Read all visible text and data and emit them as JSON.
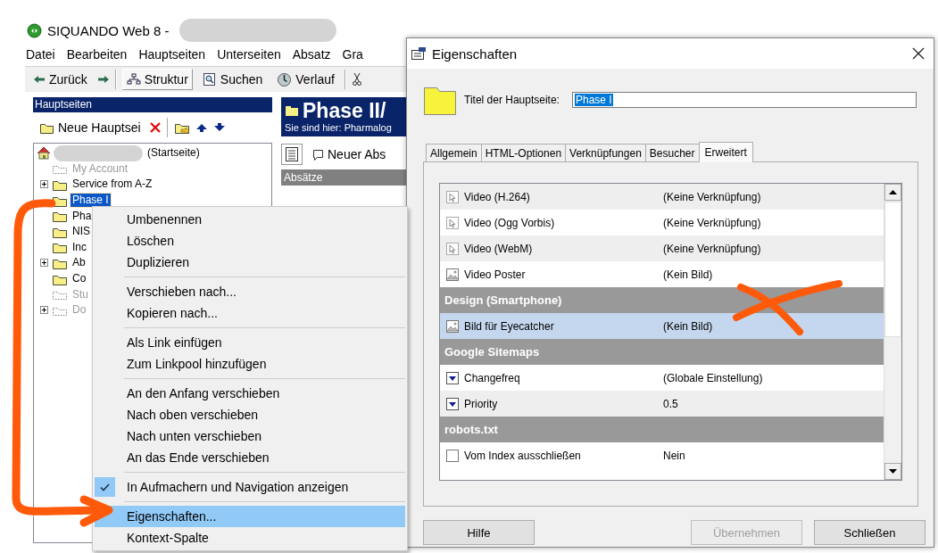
{
  "app": {
    "title": "SIQUANDO Web 8 -",
    "menu": [
      "Datei",
      "Bearbeiten",
      "Hauptseiten",
      "Unterseiten",
      "Absatz",
      "Gra"
    ],
    "toolbar": {
      "back": "Zurück",
      "views": [
        {
          "label": "Struktur",
          "selected": true
        },
        {
          "label": "Suchen",
          "selected": false
        },
        {
          "label": "Verlauf",
          "selected": false
        }
      ]
    },
    "pages_panel": {
      "title": "Hauptseiten",
      "new_button": "Neue Hauptsei",
      "tree": [
        {
          "label": "(Startseite)",
          "kind": "home",
          "disabled": false,
          "selected": false,
          "children": [
            {
              "label": "My Account",
              "kind": "folder",
              "disabled": true,
              "selected": false,
              "collapsed": false
            },
            {
              "label": "Service from A-Z",
              "kind": "folder",
              "disabled": false,
              "selected": false,
              "collapsed": true
            },
            {
              "label": "Phase I",
              "kind": "folder",
              "disabled": false,
              "selected": true,
              "collapsed": false
            },
            {
              "label": "Pha",
              "kind": "folder",
              "disabled": false,
              "selected": false,
              "collapsed": false
            },
            {
              "label": "NIS",
              "kind": "folder",
              "disabled": false,
              "selected": false,
              "collapsed": false
            },
            {
              "label": "Inc",
              "kind": "folder",
              "disabled": false,
              "selected": false,
              "collapsed": false
            },
            {
              "label": "Ab",
              "kind": "folder",
              "disabled": false,
              "selected": false,
              "collapsed": true
            },
            {
              "label": "Co",
              "kind": "folder",
              "disabled": false,
              "selected": false,
              "collapsed": false
            },
            {
              "label": "Stu",
              "kind": "folder",
              "disabled": true,
              "selected": false,
              "collapsed": false
            },
            {
              "label": "Do",
              "kind": "folder",
              "disabled": true,
              "selected": false,
              "collapsed": true
            }
          ]
        }
      ]
    },
    "page_panel": {
      "title": "Phase II/",
      "breadcrumb": "Sie sind hier: Pharmalog",
      "new_button": "Neuer Abs",
      "section": "Absätze"
    }
  },
  "context_menu": {
    "groups": [
      [
        {
          "label": "Umbenennen",
          "checked": false,
          "selected": false
        },
        {
          "label": "Löschen",
          "checked": false,
          "selected": false
        },
        {
          "label": "Duplizieren",
          "checked": false,
          "selected": false
        }
      ],
      [
        {
          "label": "Verschieben nach...",
          "checked": false,
          "selected": false
        },
        {
          "label": "Kopieren nach...",
          "checked": false,
          "selected": false
        }
      ],
      [
        {
          "label": "Als Link einfügen",
          "checked": false,
          "selected": false
        },
        {
          "label": "Zum Linkpool hinzufügen",
          "checked": false,
          "selected": false
        }
      ],
      [
        {
          "label": "An den Anfang verschieben",
          "checked": false,
          "selected": false
        },
        {
          "label": "Nach oben verschieben",
          "checked": false,
          "selected": false
        },
        {
          "label": "Nach unten verschieben",
          "checked": false,
          "selected": false
        },
        {
          "label": "An das Ende verschieben",
          "checked": false,
          "selected": false
        }
      ],
      [
        {
          "label": "In Aufmachern und Navigation anzeigen",
          "checked": true,
          "selected": false
        }
      ],
      [
        {
          "label": "Eigenschaften...",
          "checked": false,
          "selected": true
        },
        {
          "label": "Kontext-Spalte",
          "checked": false,
          "selected": false
        }
      ]
    ]
  },
  "dialog": {
    "title": "Eigenschaften",
    "field_label": "Titel der Hauptseite:",
    "field_value": "Phase I",
    "tabs": [
      {
        "label": "Allgemein",
        "selected": false
      },
      {
        "label": "HTML-Optionen",
        "selected": false
      },
      {
        "label": "Verknüpfungen",
        "selected": false
      },
      {
        "label": "Besucher",
        "selected": false
      },
      {
        "label": "Erweitert",
        "selected": true
      }
    ],
    "rows": [
      {
        "kind": "link",
        "label": "Video (H.264)",
        "value": "(Keine Verknüpfung)",
        "selected": false
      },
      {
        "kind": "link",
        "label": "Video (Ogg Vorbis)",
        "value": "(Keine Verknüpfung)",
        "selected": false
      },
      {
        "kind": "link",
        "label": "Video (WebM)",
        "value": "(Keine Verknüpfung)",
        "selected": false
      },
      {
        "kind": "image",
        "label": "Video Poster",
        "value": "(Kein Bild)",
        "selected": false
      },
      {
        "kind": "section",
        "label": "Design (Smartphone)"
      },
      {
        "kind": "image",
        "label": "Bild für Eyecatcher",
        "value": "(Kein Bild)",
        "selected": true
      },
      {
        "kind": "section",
        "label": "Google Sitemaps"
      },
      {
        "kind": "dropdown",
        "label": "Changefreq",
        "value": "(Globale Einstellung)",
        "selected": false
      },
      {
        "kind": "dropdown",
        "label": "Priority",
        "value": "0.5",
        "selected": false
      },
      {
        "kind": "section",
        "label": "robots.txt"
      },
      {
        "kind": "checkbox",
        "label": "Vom Index ausschließen",
        "value": "Nein",
        "selected": false,
        "checked": false
      }
    ],
    "buttons": [
      {
        "label": "Hilfe",
        "disabled": false
      },
      {
        "label": "Übernehmen",
        "disabled": true
      },
      {
        "label": "Schließen",
        "disabled": false
      }
    ]
  }
}
